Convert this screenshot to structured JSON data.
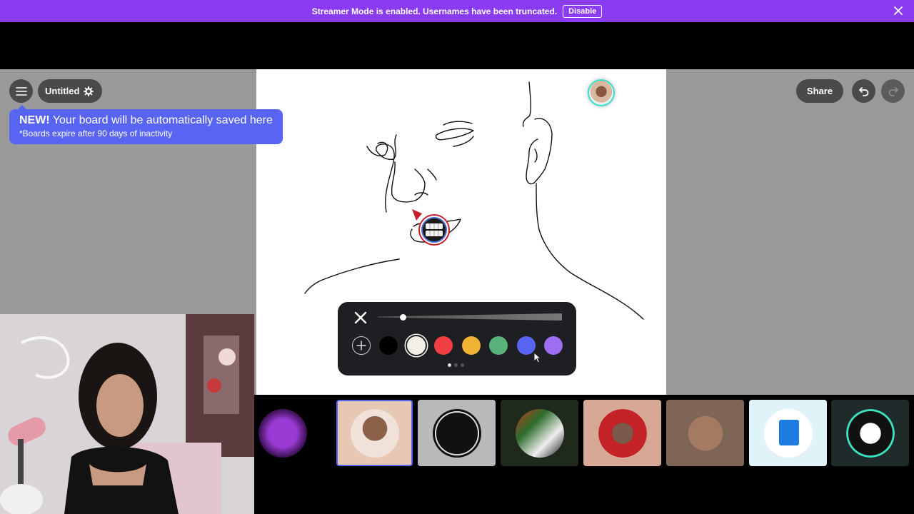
{
  "banner": {
    "message": "Streamer Mode is enabled. Usernames have been truncated.",
    "disable_label": "Disable",
    "icon_close": "close-icon"
  },
  "toolbar": {
    "menu_icon": "hamburger-menu-icon",
    "board_title": "Untitled",
    "settings_icon": "gear-icon",
    "share_label": "Share",
    "undo_icon": "undo-icon",
    "redo_icon": "redo-icon"
  },
  "tooltip": {
    "headline_bold": "NEW!",
    "headline_rest": " Your board will be automatically saved here",
    "subtext": "*Boards expire after 90 days of inactivity"
  },
  "palette": {
    "close_icon": "close-icon",
    "add_icon": "plus-icon",
    "colors": [
      "#000000",
      "#f2f0e6",
      "#f23f43",
      "#f0b232",
      "#57b37a",
      "#5865f2",
      "#9b6ff0"
    ],
    "selected_index": 1,
    "page_count": 3,
    "current_page": 1
  },
  "stickers": [
    {
      "name": "purple-cat-sticker",
      "bg": "#000000"
    },
    {
      "name": "man-portrait-sticker",
      "bg": "#e7c8b5"
    },
    {
      "name": "ok-logo-sticker",
      "bg": "#b9b9b9"
    },
    {
      "name": "manga-zuzun-sticker",
      "bg": "#1f2a1c"
    },
    {
      "name": "red-hood-sticker",
      "bg": "#d8a896"
    },
    {
      "name": "teddy-bears-sticker",
      "bg": "#7f6556"
    },
    {
      "name": "sound-document-sticker",
      "bg": "#dff3f8"
    },
    {
      "name": "teeth-mouth-sticker",
      "bg": "#1f2a2a"
    }
  ],
  "colors": {
    "banner": "#8b3bf2",
    "accent": "#5865f2",
    "palette_bg": "#1e1f22",
    "workspace_bg": "#9a9a9a"
  }
}
